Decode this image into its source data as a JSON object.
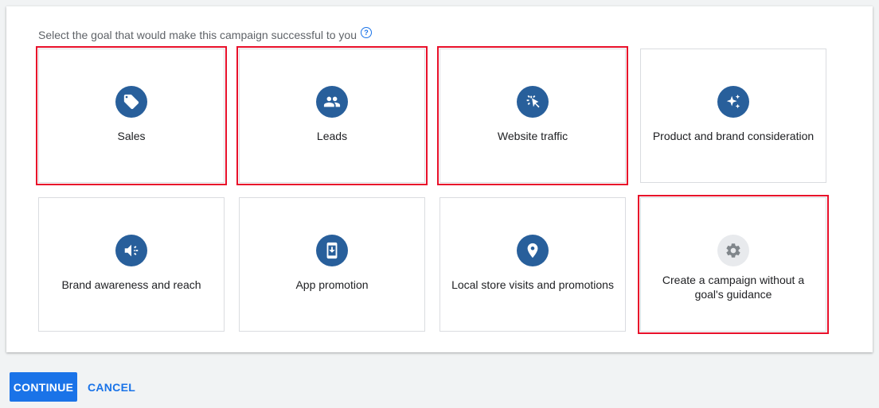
{
  "prompt": {
    "text": "Select the goal that would make this campaign successful to you",
    "help_icon": "help-circle-icon",
    "help_glyph": "?"
  },
  "goals": [
    {
      "label": "Sales",
      "icon": "tag-icon",
      "selected": true
    },
    {
      "label": "Leads",
      "icon": "people-icon",
      "selected": true
    },
    {
      "label": "Website traffic",
      "icon": "cursor-click-icon",
      "selected": true
    },
    {
      "label": "Product and brand consideration",
      "icon": "sparkle-icon",
      "selected": false
    },
    {
      "label": "Brand awareness and reach",
      "icon": "megaphone-icon",
      "selected": false
    },
    {
      "label": "App promotion",
      "icon": "phone-download-icon",
      "selected": false
    },
    {
      "label": "Local store visits and promotions",
      "icon": "location-pin-icon",
      "selected": false
    },
    {
      "label": "Create a campaign without a goal's guidance",
      "icon": "gear-icon",
      "selected": true
    }
  ],
  "actions": {
    "continue_label": "CONTINUE",
    "cancel_label": "CANCEL"
  },
  "colors": {
    "icon_bg": "#285f9b",
    "accent": "#1a73e8",
    "selection_outline": "#e8102a",
    "neutral_icon_bg": "#e8eaed"
  }
}
